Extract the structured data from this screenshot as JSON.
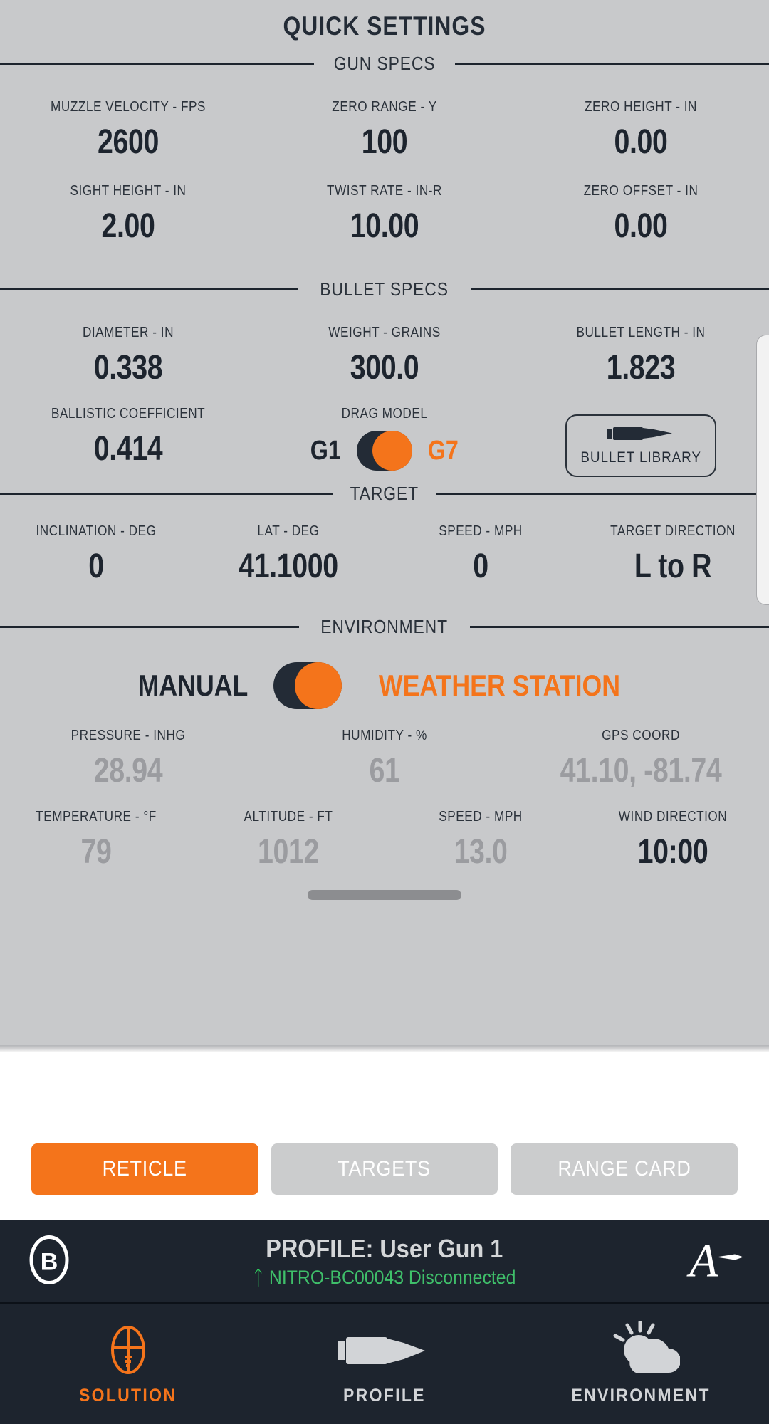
{
  "header": {
    "title": "QUICK SETTINGS"
  },
  "sections": {
    "gun": {
      "title": "GUN SPECS"
    },
    "bullet": {
      "title": "BULLET SPECS"
    },
    "target": {
      "title": "TARGET"
    },
    "environment": {
      "title": "ENVIRONMENT"
    }
  },
  "gun_specs": {
    "row1": [
      {
        "label": "MUZZLE VELOCITY - FPS",
        "value": "2600"
      },
      {
        "label": "ZERO RANGE - Y",
        "value": "100"
      },
      {
        "label": "ZERO HEIGHT - IN",
        "value": "0.00"
      }
    ],
    "row2": [
      {
        "label": "SIGHT HEIGHT - IN",
        "value": "2.00"
      },
      {
        "label": "TWIST RATE - IN-R",
        "value": "10.00"
      },
      {
        "label": "ZERO OFFSET - IN",
        "value": "0.00"
      }
    ]
  },
  "bullet_specs": {
    "row1": [
      {
        "label": "DIAMETER - IN",
        "value": "0.338"
      },
      {
        "label": "WEIGHT - GRAINS",
        "value": "300.0"
      },
      {
        "label": "BULLET LENGTH - IN",
        "value": "1.823"
      }
    ],
    "ballistic_coefficient": {
      "label": "BALLISTIC COEFFICIENT",
      "value": "0.414"
    },
    "drag_model": {
      "label": "DRAG MODEL",
      "option_left": "G1",
      "option_right": "G7",
      "selected": "G7"
    },
    "bullet_library_button": {
      "label": "BULLET LIBRARY",
      "icon": "cartridge-icon"
    }
  },
  "target": [
    {
      "label": "INCLINATION - DEG",
      "value": "0"
    },
    {
      "label": "LAT - DEG",
      "value": "41.1000"
    },
    {
      "label": "SPEED - MPH",
      "value": "0"
    },
    {
      "label": "TARGET DIRECTION",
      "value": "L to R"
    }
  ],
  "environment": {
    "mode_toggle": {
      "option_left": "MANUAL",
      "option_right": "WEATHER STATION",
      "selected": "WEATHER STATION"
    },
    "row1": [
      {
        "label": "PRESSURE - INHG",
        "value": "28.94",
        "dim": true
      },
      {
        "label": "HUMIDITY - %",
        "value": "61",
        "dim": true
      },
      {
        "label": "GPS COORD",
        "value": "41.10, -81.74",
        "dim": true
      }
    ],
    "row2": [
      {
        "label": "TEMPERATURE - °F",
        "value": "79",
        "dim": true
      },
      {
        "label": "ALTITUDE - FT",
        "value": "1012",
        "dim": true
      },
      {
        "label": "SPEED - MPH",
        "value": "13.0",
        "dim": true
      },
      {
        "label": "WIND DIRECTION",
        "value": "10:00",
        "dim": false
      }
    ]
  },
  "actions": [
    {
      "label": "RETICLE",
      "active": true
    },
    {
      "label": "TARGETS",
      "active": false
    },
    {
      "label": "RANGE CARD",
      "active": false
    }
  ],
  "profile_bar": {
    "title": "PROFILE: User Gun 1",
    "bluetooth_icon": "bluetooth-icon",
    "status": "NITRO-BC00043 Disconnected",
    "left_logo": "b-circle-logo",
    "right_logo": "a-bullet-logo"
  },
  "tabs": [
    {
      "label": "SOLUTION",
      "icon": "reticle-icon",
      "active": true
    },
    {
      "label": "PROFILE",
      "icon": "cartridge-icon",
      "active": false
    },
    {
      "label": "ENVIRONMENT",
      "icon": "sun-cloud-icon",
      "active": false
    }
  ],
  "colors": {
    "accent_orange": "#f4741b",
    "dark_navy": "#1d242e",
    "panel_grey": "#c8c9cb",
    "dim_grey": "#9b9ca0",
    "status_green": "#3fbf6a"
  }
}
